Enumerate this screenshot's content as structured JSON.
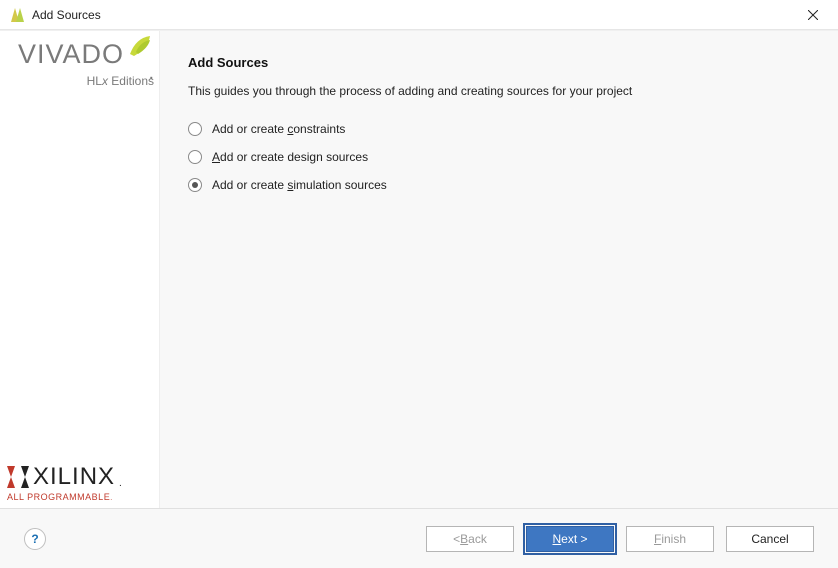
{
  "window": {
    "title": "Add Sources"
  },
  "branding": {
    "vivado": "VIVADO",
    "vivado_dot": ".",
    "hlx": "HLx Editions",
    "xilinx": "XILINX",
    "xilinx_dot": ".",
    "all_prog": "ALL PROGRAMMABLE",
    "all_prog_dot": "."
  },
  "content": {
    "heading": "Add Sources",
    "subtext": "This guides you through the process of adding and creating sources for your project",
    "options": [
      {
        "pre": "Add or create ",
        "u": "c",
        "post": "onstraints",
        "selected": false
      },
      {
        "pre": "",
        "u": "A",
        "post": "dd or create design sources",
        "selected": false
      },
      {
        "pre": "Add or create ",
        "u": "s",
        "post": "imulation sources",
        "selected": true
      }
    ]
  },
  "footer": {
    "help": "?",
    "back_pre": "< ",
    "back_u": "B",
    "back_post": "ack",
    "next_u": "N",
    "next_post": "ext >",
    "finish_u": "F",
    "finish_post": "inish",
    "cancel": "Cancel"
  }
}
